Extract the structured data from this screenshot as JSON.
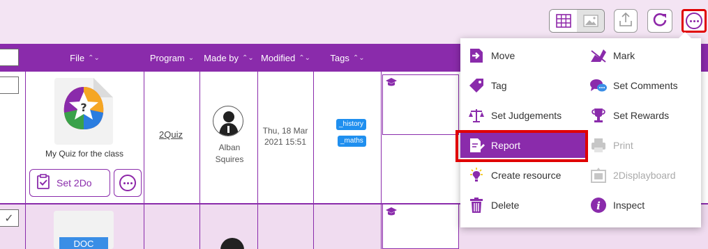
{
  "toolbar": {
    "icons": [
      "grid-view-icon",
      "image-view-icon",
      "upload-icon",
      "refresh-icon",
      "more-options-icon"
    ]
  },
  "table": {
    "headers": [
      {
        "label": "File",
        "sort": "⌃⌄"
      },
      {
        "label": "Program",
        "sort": "⌄"
      },
      {
        "label": "Made by",
        "sort": "⌃⌄"
      },
      {
        "label": "Modified",
        "sort": "⌃⌄"
      },
      {
        "label": "Tags",
        "sort": "⌃⌄"
      }
    ],
    "row1": {
      "file_name": "My Quiz for the class",
      "set2do_label": "Set 2Do",
      "program": "2Quiz",
      "made_by_line1": "Alban",
      "made_by_line2": "Squires",
      "modified_line1": "Thu, 18 Mar",
      "modified_line2": "2021 15:51",
      "tags": [
        "_history",
        "_maths"
      ]
    },
    "row2": {
      "file_type_label": "DOC",
      "checked": true
    }
  },
  "menu": {
    "left_items": [
      {
        "label": "Move",
        "icon": "move-icon"
      },
      {
        "label": "Tag",
        "icon": "tag-icon"
      },
      {
        "label": "Set Judgements",
        "icon": "scales-icon"
      },
      {
        "label": "Report",
        "icon": "report-icon"
      },
      {
        "label": "Create resource",
        "icon": "lightbulb-icon"
      },
      {
        "label": "Delete",
        "icon": "trash-icon"
      }
    ],
    "right_items": [
      {
        "label": "Mark",
        "icon": "mark-icon"
      },
      {
        "label": "Set Comments",
        "icon": "comments-icon"
      },
      {
        "label": "Set Rewards",
        "icon": "trophy-icon"
      },
      {
        "label": "Print",
        "icon": "print-icon"
      },
      {
        "label": "2Displayboard",
        "icon": "displayboard-icon"
      },
      {
        "label": "Inspect",
        "icon": "info-icon"
      }
    ]
  },
  "colors": {
    "accent": "#8a2bab",
    "highlight": "#e00000",
    "tag": "#1f8fef"
  }
}
